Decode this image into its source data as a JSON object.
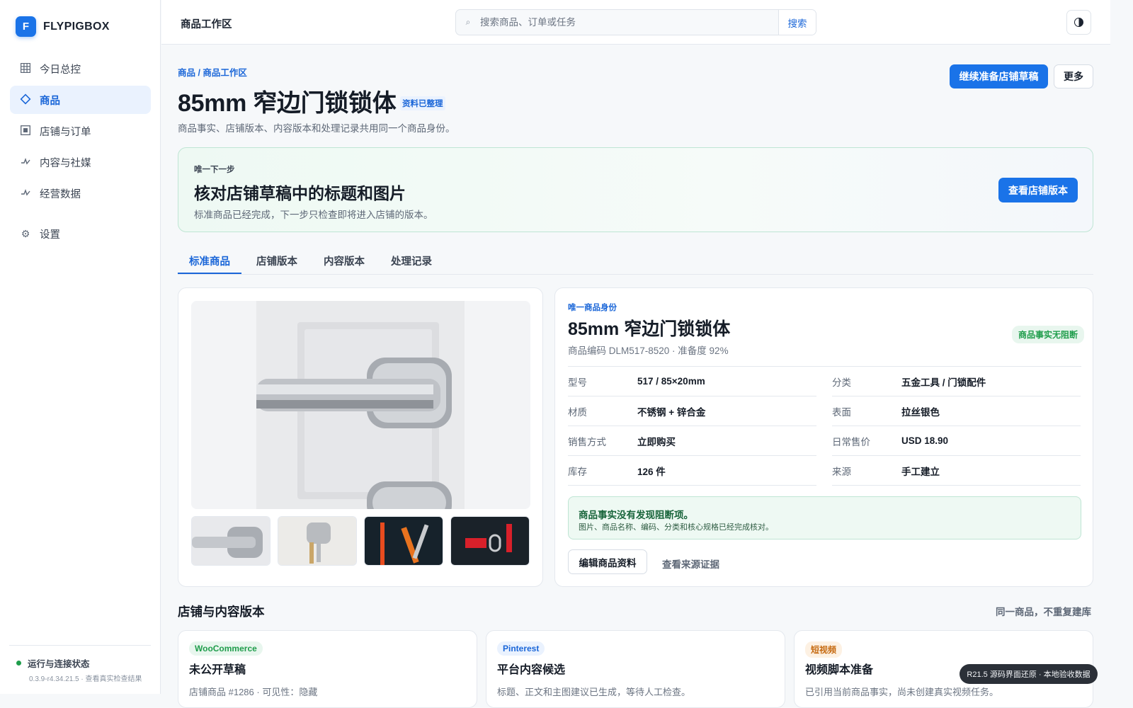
{
  "brand": {
    "logo_letter": "F",
    "name": "FLYPIGBOX"
  },
  "sidebar": {
    "items": [
      {
        "label": "今日总控",
        "icon": "grid-icon"
      },
      {
        "label": "商品",
        "icon": "diamond-icon",
        "active": true
      },
      {
        "label": "店铺与订单",
        "icon": "store-icon"
      },
      {
        "label": "内容与社媒",
        "icon": "pulse-icon"
      },
      {
        "label": "经营数据",
        "icon": "pulse-icon"
      }
    ],
    "settings": {
      "label": "设置",
      "icon": "gear-icon"
    },
    "status": {
      "title": "运行与连接状态",
      "sub": "0.3.9-r4.34.21.5 · 查看真实检查结果"
    }
  },
  "topbar": {
    "title": "商品工作区",
    "search_placeholder": "搜索商品、订单或任务",
    "search_button": "搜索"
  },
  "header": {
    "breadcrumb": "商品 / 商品工作区",
    "title": "85mm 窄边门锁锁体",
    "badge": "资料已整理",
    "description": "商品事实、店铺版本、内容版本和处理记录共用同一个商品身份。",
    "primary_action": "继续准备店铺草稿",
    "more_action": "更多"
  },
  "next_step": {
    "label": "唯一下一步",
    "title": "核对店铺草稿中的标题和图片",
    "description": "标准商品已经完成，下一步只检查即将进入店铺的版本。",
    "action": "查看店铺版本"
  },
  "tabs": [
    {
      "label": "标准商品",
      "active": true
    },
    {
      "label": "店铺版本"
    },
    {
      "label": "内容版本"
    },
    {
      "label": "处理记录"
    }
  ],
  "identity": {
    "label": "唯一商品身份",
    "title": "85mm 窄边门锁锁体",
    "sub": "商品编码 DLM517-8520 · 准备度 92%",
    "status_badge": "商品事实无阻断",
    "specs": [
      {
        "key": "型号",
        "value": "517 / 85×20mm"
      },
      {
        "key": "分类",
        "value": "五金工具 / 门锁配件"
      },
      {
        "key": "材质",
        "value": "不锈钢 + 锌合金"
      },
      {
        "key": "表面",
        "value": "拉丝银色"
      },
      {
        "key": "销售方式",
        "value": "立即购买"
      },
      {
        "key": "日常售价",
        "value": "USD 18.90"
      },
      {
        "key": "库存",
        "value": "126 件"
      },
      {
        "key": "来源",
        "value": "手工建立"
      }
    ],
    "check_title": "商品事实没有发现阻断项。",
    "check_desc": "图片、商品名称、编码、分类和核心规格已经完成核对。",
    "edit_action": "编辑商品资料",
    "evidence_action": "查看来源证据"
  },
  "versions": {
    "title": "店铺与内容版本",
    "note": "同一商品，不重复建库",
    "cards": [
      {
        "tag": "WooCommerce",
        "tag_color": "#1f9d4b",
        "tag_bg": "#e8f6ee",
        "title": "未公开草稿",
        "desc": "店铺商品 #1286 · 可见性：隐藏"
      },
      {
        "tag": "Pinterest",
        "tag_color": "#1a66d8",
        "tag_bg": "#eaf2fe",
        "title": "平台内容候选",
        "desc": "标题、正文和主图建议已生成，等待人工检查。"
      },
      {
        "tag": "短视频",
        "tag_color": "#c66a10",
        "tag_bg": "#fdf1e3",
        "title": "视频脚本准备",
        "desc": "已引用当前商品事实，尚未创建真实视频任务。"
      }
    ]
  },
  "toast": "R21.5 源码界面还原 · 本地验收数据",
  "colors": {
    "accent": "#1a73e8",
    "success": "#1f9d4b",
    "sidebar_active_bg": "#eaf2fe"
  }
}
